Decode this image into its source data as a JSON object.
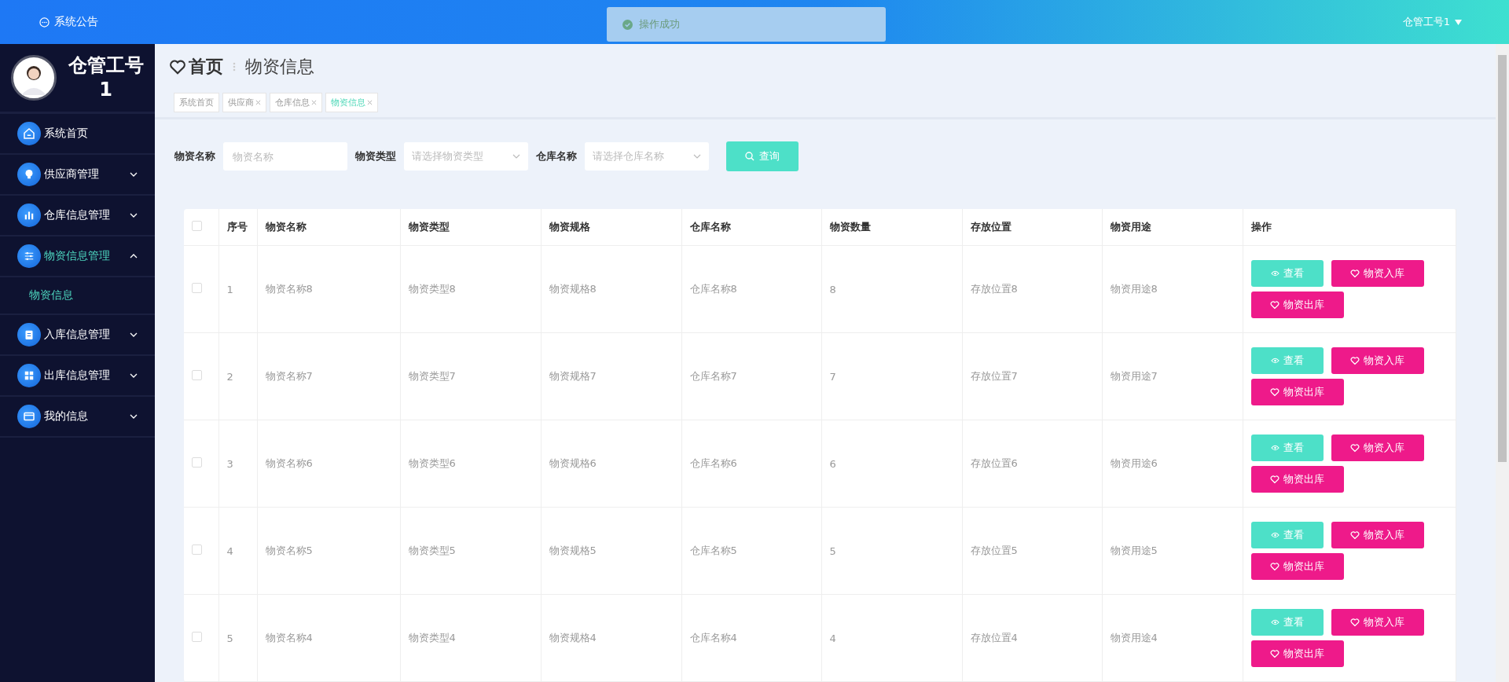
{
  "header": {
    "notice": "系统公告",
    "toast": "操作成功",
    "user": "仓管工号1"
  },
  "sidebar": {
    "profile_name": "仓管工号1",
    "items": [
      {
        "label": "系统首页",
        "kind": "home",
        "expanded": false,
        "has_children": false
      },
      {
        "label": "供应商管理",
        "kind": "bulb",
        "expanded": false,
        "has_children": true
      },
      {
        "label": "仓库信息管理",
        "kind": "chart",
        "expanded": false,
        "has_children": true
      },
      {
        "label": "物资信息管理",
        "kind": "sliders",
        "expanded": true,
        "has_children": true,
        "children": [
          {
            "label": "物资信息",
            "selected": true
          }
        ]
      },
      {
        "label": "入库信息管理",
        "kind": "clipboard",
        "expanded": false,
        "has_children": true
      },
      {
        "label": "出库信息管理",
        "kind": "grid",
        "expanded": false,
        "has_children": true
      },
      {
        "label": "我的信息",
        "kind": "card",
        "expanded": false,
        "has_children": true
      }
    ]
  },
  "breadcrumb": [
    "首页",
    "物资信息"
  ],
  "tabs": [
    {
      "label": "系统首页",
      "closable": false,
      "selected": false
    },
    {
      "label": "供应商",
      "closable": true,
      "selected": false
    },
    {
      "label": "仓库信息",
      "closable": true,
      "selected": false
    },
    {
      "label": "物资信息",
      "closable": true,
      "selected": true
    }
  ],
  "filters": [
    {
      "label": "物资名称",
      "placeholder": "物资名称",
      "kind": "text"
    },
    {
      "label": "物资类型",
      "placeholder": "请选择物资类型",
      "kind": "select"
    },
    {
      "label": "仓库名称",
      "placeholder": "请选择仓库名称",
      "kind": "select"
    }
  ],
  "search_button": "查询",
  "table": {
    "all_checked": false,
    "columns": [
      "序号",
      "物资名称",
      "物资类型",
      "物资规格",
      "仓库名称",
      "物资数量",
      "存放位置",
      "物资用途",
      "操作"
    ],
    "rows": [
      {
        "checked": false,
        "cells": [
          "1",
          "物资名称8",
          "物资类型8",
          "物资规格8",
          "仓库名称8",
          "8",
          "存放位置8",
          "物资用途8"
        ],
        "actions": [
          {
            "label": "查看",
            "kind": "view"
          },
          {
            "label": "物资入库",
            "kind": "in"
          },
          {
            "label": "物资出库",
            "kind": "out"
          }
        ]
      },
      {
        "checked": false,
        "cells": [
          "2",
          "物资名称7",
          "物资类型7",
          "物资规格7",
          "仓库名称7",
          "7",
          "存放位置7",
          "物资用途7"
        ],
        "actions": [
          {
            "label": "查看",
            "kind": "view"
          },
          {
            "label": "物资入库",
            "kind": "in"
          },
          {
            "label": "物资出库",
            "kind": "out"
          }
        ]
      },
      {
        "checked": false,
        "cells": [
          "3",
          "物资名称6",
          "物资类型6",
          "物资规格6",
          "仓库名称6",
          "6",
          "存放位置6",
          "物资用途6"
        ],
        "actions": [
          {
            "label": "查看",
            "kind": "view"
          },
          {
            "label": "物资入库",
            "kind": "in"
          },
          {
            "label": "物资出库",
            "kind": "out"
          }
        ]
      },
      {
        "checked": false,
        "cells": [
          "4",
          "物资名称5",
          "物资类型5",
          "物资规格5",
          "仓库名称5",
          "5",
          "存放位置5",
          "物资用途5"
        ],
        "actions": [
          {
            "label": "查看",
            "kind": "view"
          },
          {
            "label": "物资入库",
            "kind": "in"
          },
          {
            "label": "物资出库",
            "kind": "out"
          }
        ]
      },
      {
        "checked": false,
        "cells": [
          "5",
          "物资名称4",
          "物资类型4",
          "物资规格4",
          "仓库名称4",
          "4",
          "存放位置4",
          "物资用途4"
        ],
        "actions": [
          {
            "label": "查看",
            "kind": "view"
          },
          {
            "label": "物资入库",
            "kind": "in"
          },
          {
            "label": "物资出库",
            "kind": "out"
          }
        ]
      }
    ]
  }
}
